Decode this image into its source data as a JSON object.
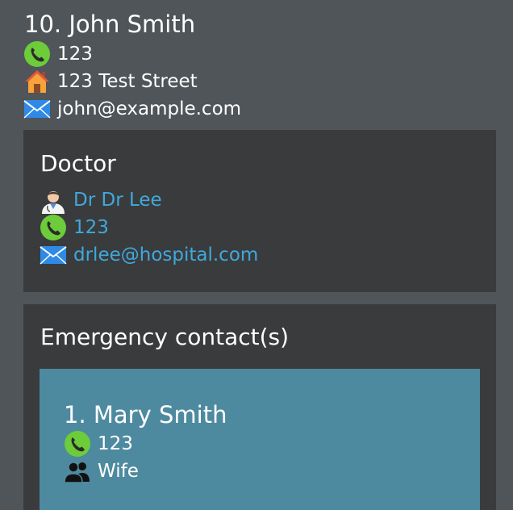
{
  "patient": {
    "name": "10. John Smith",
    "phone": "123",
    "address": "123 Test Street",
    "email": "john@example.com"
  },
  "doctor_section": {
    "title": "Doctor",
    "name": "Dr Dr Lee",
    "phone": "123",
    "email": "drlee@hospital.com"
  },
  "emergency_section": {
    "title": "Emergency contact(s)",
    "contacts": [
      {
        "name": "1. Mary Smith",
        "phone": "123",
        "relationship": "Wife"
      }
    ]
  },
  "icons": {
    "phone": "phone-icon",
    "address": "house-icon",
    "email": "envelope-icon",
    "doctor": "doctor-icon",
    "relationship": "people-icon"
  },
  "colors": {
    "background": "#4f5559",
    "panel": "#3a3b3d",
    "contact_card": "#4e8a9f",
    "link": "#3fa9dd",
    "phone_icon": "#6ccc3a"
  }
}
